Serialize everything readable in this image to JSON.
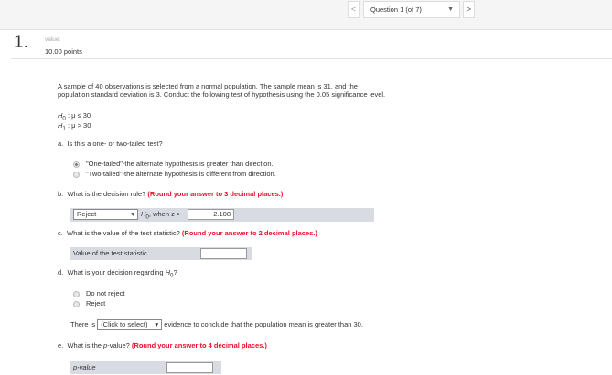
{
  "nav": {
    "prev": "<",
    "next": ">",
    "question_select": "Question 1 (of 7)",
    "caret": "▼"
  },
  "question": {
    "number": "1.",
    "value_label": "value:",
    "points": "10.00 points"
  },
  "problem": {
    "line1": "A sample of 40 observations is selected from a normal population. The sample mean is 31, and the",
    "line2": "population standard deviation is 3. Conduct the following test of hypothesis using the 0.05 significance level.",
    "h0": "H",
    "h0_sub": "0",
    "h0_rest": " : μ ≤ 30",
    "h1": "H",
    "h1_sub": "1",
    "h1_rest": " : μ > 30"
  },
  "a": {
    "label": "a.",
    "question": "Is this a one- or two-tailed test?",
    "options": [
      "\"One-tailed\"-the alternate hypothesis is greater than direction.",
      "\"Two-tailed\"-the alternate hypothesis is different from direction."
    ],
    "selected": 0
  },
  "b": {
    "label": "b.",
    "question": "What is the decision rule?",
    "hint": "(Round your answer to 3 decimal places.)",
    "select": "Reject",
    "caret": "▾",
    "h": "H",
    "h_sub": "0",
    "when": ", when z >",
    "value": "2.108"
  },
  "c": {
    "label": "c.",
    "question": "What is the value of the test statistic?",
    "hint": "(Round your answer to 2 decimal places.)",
    "field_label": "Value of the test statistic",
    "value": ""
  },
  "d": {
    "label": "d.",
    "question": "What is your decision regarding ",
    "h": "H",
    "h_sub": "0",
    "q": "?",
    "options": [
      "Do not reject",
      "Reject"
    ],
    "there_is": "There is",
    "select": "(Click to select)",
    "caret": "▾",
    "evidence": "evidence to conclude that the population mean is greater than 30."
  },
  "e": {
    "label": "e.",
    "q1": "What is the ",
    "p": "p",
    "q2": "-value?",
    "hint": "(Round your answer to 4 decimal places.)",
    "field_label": "p-value",
    "value": ""
  }
}
